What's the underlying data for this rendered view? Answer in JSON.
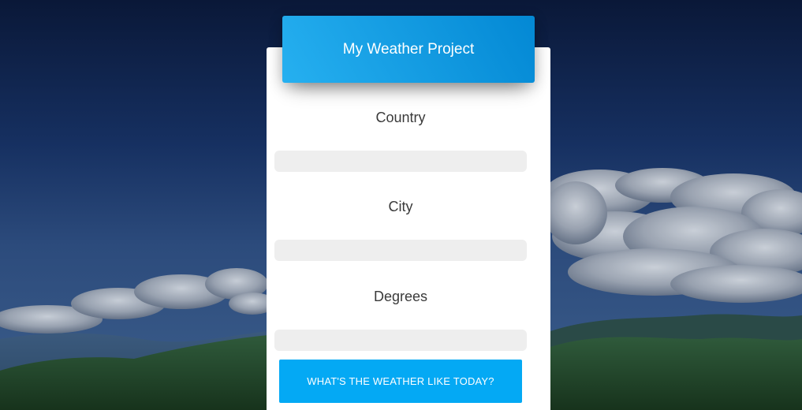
{
  "colors": {
    "header_gradient_start": "#26b0f0",
    "header_gradient_end": "#0388d4",
    "button": "#04a9f4",
    "input_bg": "#eeeeee",
    "card": "#ffffff"
  },
  "header": {
    "title": "My Weather Project"
  },
  "form": {
    "fields": [
      {
        "label": "Country",
        "value": "",
        "placeholder": ""
      },
      {
        "label": "City",
        "value": "",
        "placeholder": ""
      },
      {
        "label": "Degrees",
        "value": "",
        "placeholder": ""
      }
    ],
    "submit_label": "WHAT'S THE WEATHER LIKE TODAY?"
  }
}
